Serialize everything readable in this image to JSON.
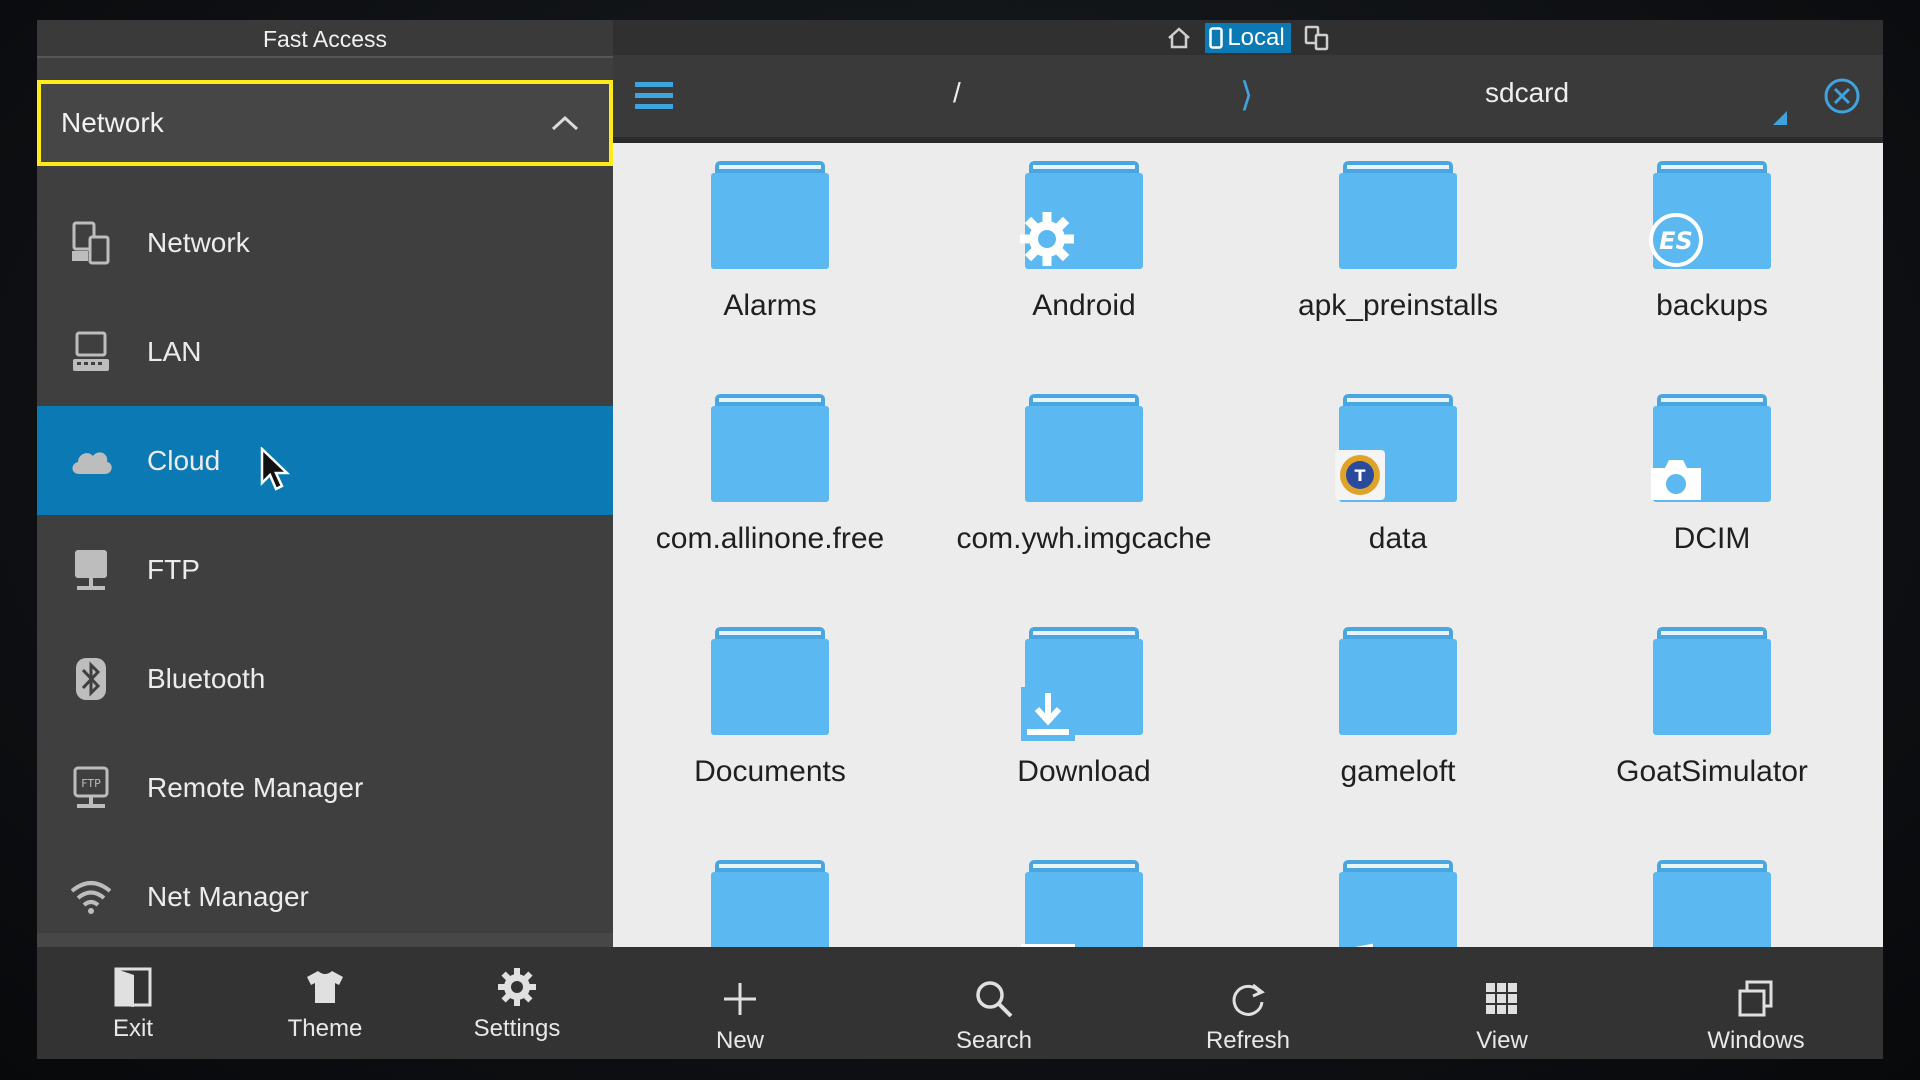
{
  "drawer": {
    "title": "Fast Access",
    "section": "Network",
    "items": [
      {
        "label": "Network",
        "icon": "network-icon",
        "active": false
      },
      {
        "label": "LAN",
        "icon": "lan-icon",
        "active": false
      },
      {
        "label": "Cloud",
        "icon": "cloud-icon",
        "active": true
      },
      {
        "label": "FTP",
        "icon": "ftp-icon",
        "active": false
      },
      {
        "label": "Bluetooth",
        "icon": "bluetooth-icon",
        "active": false
      },
      {
        "label": "Remote Manager",
        "icon": "remote-manager-icon",
        "active": false
      },
      {
        "label": "Net Manager",
        "icon": "wifi-icon",
        "active": false
      }
    ],
    "toolbar": [
      {
        "label": "Exit",
        "icon": "exit-icon"
      },
      {
        "label": "Theme",
        "icon": "tshirt-icon"
      },
      {
        "label": "Settings",
        "icon": "gear-icon"
      }
    ]
  },
  "topbar": {
    "local_label": "Local"
  },
  "path": {
    "root": "/",
    "separator": "⟩",
    "current": "sdcard"
  },
  "folders": [
    {
      "name": "Alarms",
      "badge": ""
    },
    {
      "name": "Android",
      "badge": "gear"
    },
    {
      "name": "apk_preinstalls",
      "badge": ""
    },
    {
      "name": "backups",
      "badge": "es"
    },
    {
      "name": "com.allinone.free",
      "badge": ""
    },
    {
      "name": "com.ywh.imgcache",
      "badge": ""
    },
    {
      "name": "data",
      "badge": "app"
    },
    {
      "name": "DCIM",
      "badge": "camera"
    },
    {
      "name": "Documents",
      "badge": ""
    },
    {
      "name": "Download",
      "badge": "download"
    },
    {
      "name": "gameloft",
      "badge": ""
    },
    {
      "name": "GoatSimulator",
      "badge": ""
    },
    {
      "name": "",
      "badge": ""
    },
    {
      "name": "",
      "badge": "video"
    },
    {
      "name": "",
      "badge": "music"
    },
    {
      "name": "",
      "badge": ""
    }
  ],
  "toolbar": [
    {
      "label": "New",
      "icon": "plus-icon"
    },
    {
      "label": "Search",
      "icon": "search-icon"
    },
    {
      "label": "Refresh",
      "icon": "refresh-icon"
    },
    {
      "label": "View",
      "icon": "grid-view-icon"
    },
    {
      "label": "Windows",
      "icon": "windows-icon"
    }
  ],
  "colors": {
    "accent": "#0a79b4",
    "highlight_border": "#ffeb1a",
    "folder": "#5bb8f0",
    "folder_tab": "#4aa6e0"
  }
}
